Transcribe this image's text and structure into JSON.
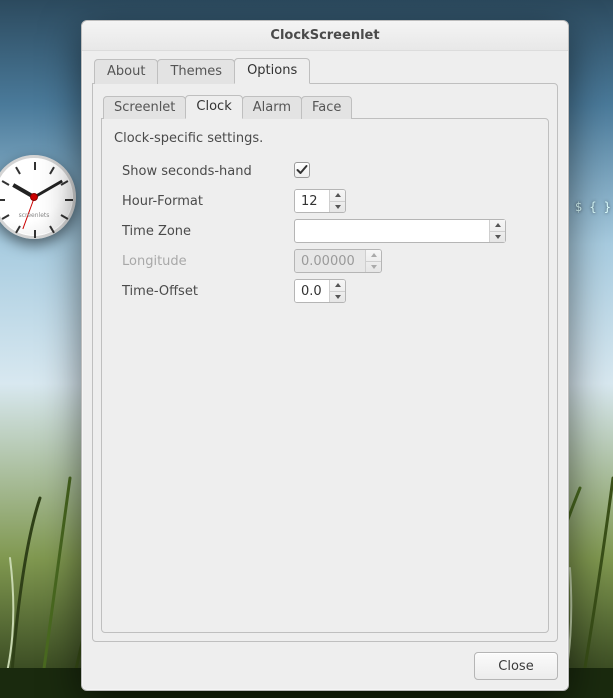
{
  "desktop": {
    "terminal_hint": "$ { }",
    "analog_brand": "screenlets"
  },
  "window": {
    "title": "ClockScreenlet",
    "close_label": "Close"
  },
  "tabs": {
    "outer": [
      {
        "label": "About"
      },
      {
        "label": "Themes"
      },
      {
        "label": "Options"
      }
    ],
    "outer_active": 2,
    "inner": [
      {
        "label": "Screenlet"
      },
      {
        "label": "Clock"
      },
      {
        "label": "Alarm"
      },
      {
        "label": "Face"
      }
    ],
    "inner_active": 1
  },
  "section": {
    "description": "Clock-specific settings."
  },
  "fields": {
    "show_seconds": {
      "label": "Show seconds-hand",
      "checked": true
    },
    "hour_format": {
      "label": "Hour-Format",
      "value": "12"
    },
    "time_zone": {
      "label": "Time Zone",
      "value": ""
    },
    "longitude": {
      "label": "Longitude",
      "value": "0.00000",
      "enabled": false
    },
    "time_offset": {
      "label": "Time-Offset",
      "value": "0.0"
    }
  }
}
